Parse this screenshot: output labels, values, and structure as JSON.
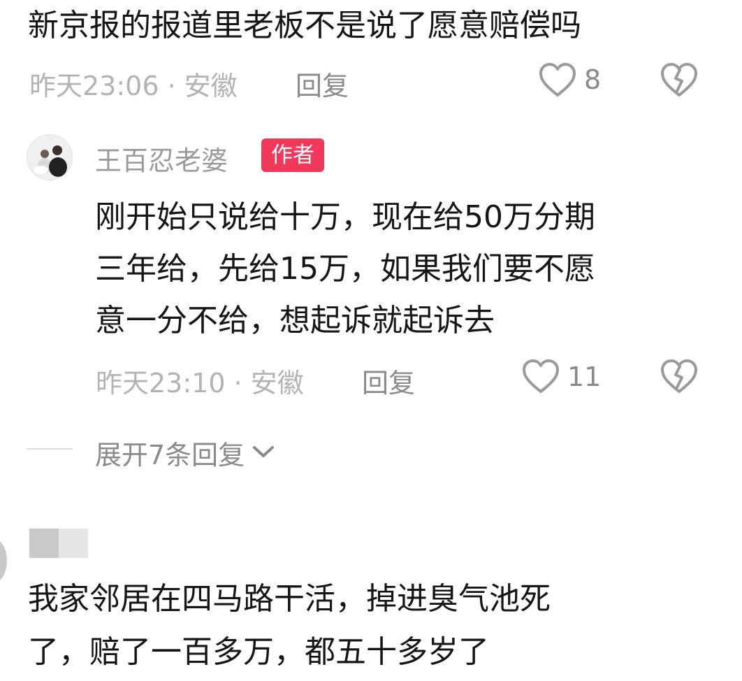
{
  "comment1": {
    "text": "新京报的报道里老板不是说了愿意赔偿吗",
    "meta": "昨天23:06 · 安徽",
    "reply_label": "回复",
    "like_count": "8"
  },
  "reply1": {
    "username": "王百忍老婆",
    "badge": "作者",
    "lines": [
      "刚开始只说给十万，现在给50万分期",
      "三年给，先给15万，如果我们要不愿",
      "意一分不给，想起诉就起诉去"
    ],
    "meta": "昨天23:10 · 安徽",
    "reply_label": "回复",
    "like_count": "11"
  },
  "expand": {
    "label": "展开7条回复"
  },
  "comment2": {
    "lines": [
      "我家邻居在四马路干活，掉进臭气池死",
      "了，赔了一百多万，都五十多岁了"
    ]
  },
  "icons": {
    "like": "heart-outline-icon",
    "dislike": "broken-heart-icon",
    "expand": "chevron-down-icon"
  },
  "colors": {
    "badge_bg": "#f1375a",
    "meta": "#b3b3b3",
    "icon": "#9a9a9a",
    "text": "#151515"
  }
}
